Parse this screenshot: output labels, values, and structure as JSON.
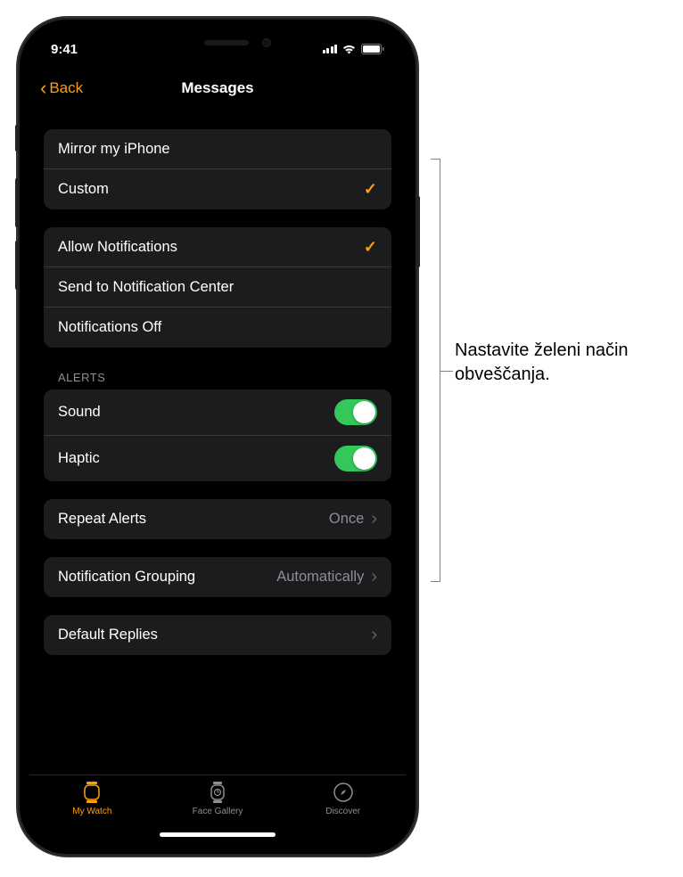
{
  "status": {
    "time": "9:41"
  },
  "nav": {
    "back": "Back",
    "title": "Messages"
  },
  "group1": {
    "mirror": "Mirror my iPhone",
    "custom": "Custom"
  },
  "group2": {
    "allow": "Allow Notifications",
    "sendTo": "Send to Notification Center",
    "off": "Notifications Off"
  },
  "alerts": {
    "header": "ALERTS",
    "sound": "Sound",
    "haptic": "Haptic"
  },
  "repeat": {
    "label": "Repeat Alerts",
    "value": "Once"
  },
  "grouping": {
    "label": "Notification Grouping",
    "value": "Automatically"
  },
  "defaultReplies": {
    "label": "Default Replies"
  },
  "tabs": {
    "watch": "My Watch",
    "gallery": "Face Gallery",
    "discover": "Discover"
  },
  "callout": "Nastavite želeni način obveščanja."
}
